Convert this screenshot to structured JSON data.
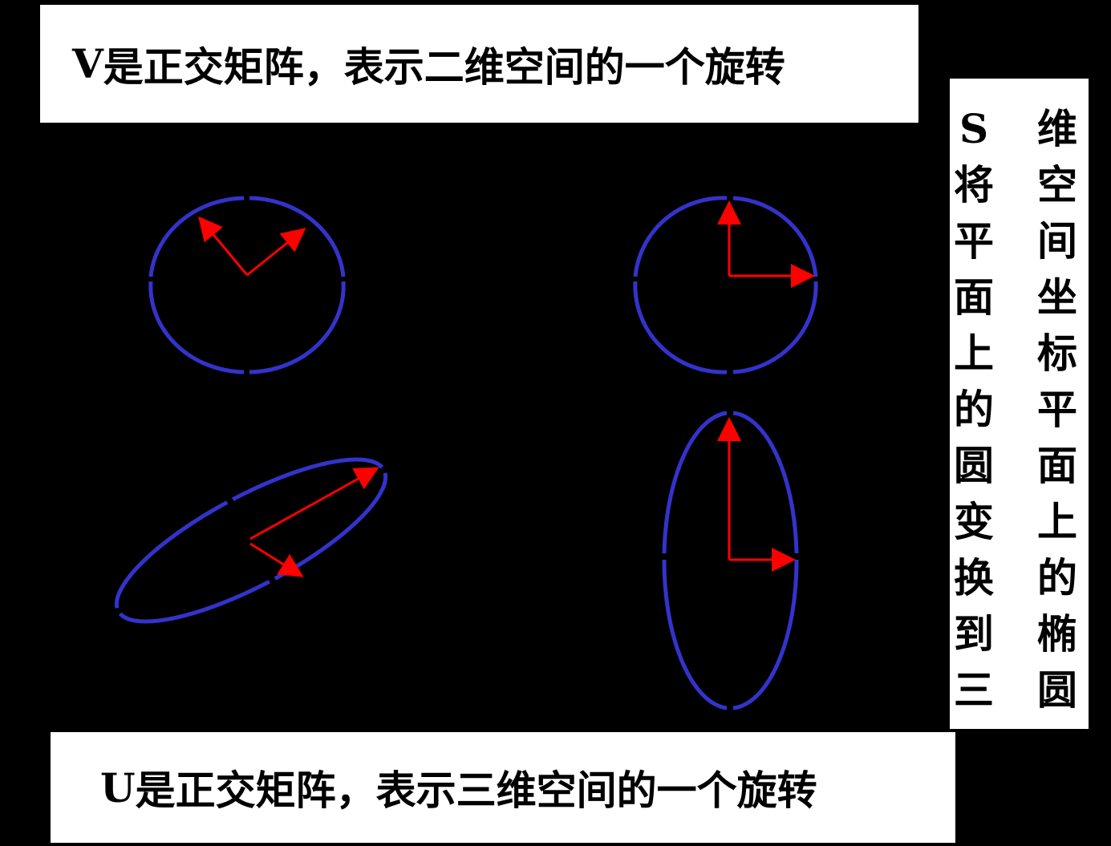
{
  "captions": {
    "v_letter": "V",
    "v_text": "是正交矩阵，表示二维空间的一个旋转",
    "u_letter": "U",
    "u_text": "是正交矩阵，表示三维空间的一个旋转",
    "s_left_column": [
      "S",
      "将",
      "平",
      "面",
      "上",
      "的",
      "圆",
      "变",
      "换",
      "到",
      "三"
    ],
    "s_right_column": [
      "维",
      "空",
      "间",
      "坐",
      "标",
      "平",
      "面",
      "上",
      "的",
      "椭",
      "圆"
    ]
  },
  "colors": {
    "background": "#000000",
    "box": "#ffffff",
    "curve": "#3333cc",
    "vector": "#ff0000"
  }
}
